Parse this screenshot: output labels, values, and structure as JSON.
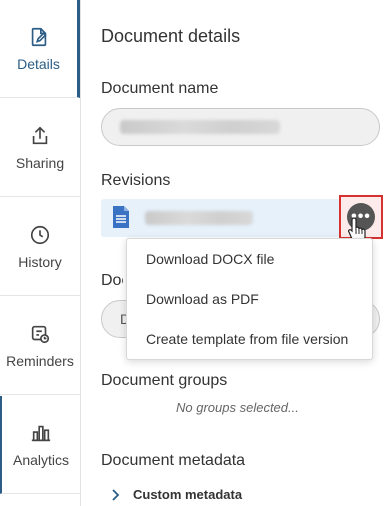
{
  "sidebar": {
    "items": [
      {
        "label": "Details",
        "icon": "document-edit-icon"
      },
      {
        "label": "Sharing",
        "icon": "share-upload-icon"
      },
      {
        "label": "History",
        "icon": "clock-icon"
      },
      {
        "label": "Reminders",
        "icon": "reminder-icon"
      },
      {
        "label": "Analytics",
        "icon": "bar-chart-icon"
      }
    ]
  },
  "main": {
    "title": "Document details",
    "document_name_label": "Document name",
    "revisions_label": "Revisions",
    "context_menu": {
      "items": [
        "Download DOCX file",
        "Download as PDF",
        "Create template from file version"
      ]
    },
    "hidden_section_label_visible": "Doc",
    "hidden_pill_text": "D",
    "document_groups_label": "Document groups",
    "document_groups_placeholder": "No groups selected...",
    "document_metadata_label": "Document metadata",
    "custom_metadata_label": "Custom metadata"
  },
  "colors": {
    "accent": "#2b5d87",
    "highlight_border": "#d63030",
    "revision_bg": "#e6f1fa",
    "doc_icon": "#3a72c4"
  }
}
